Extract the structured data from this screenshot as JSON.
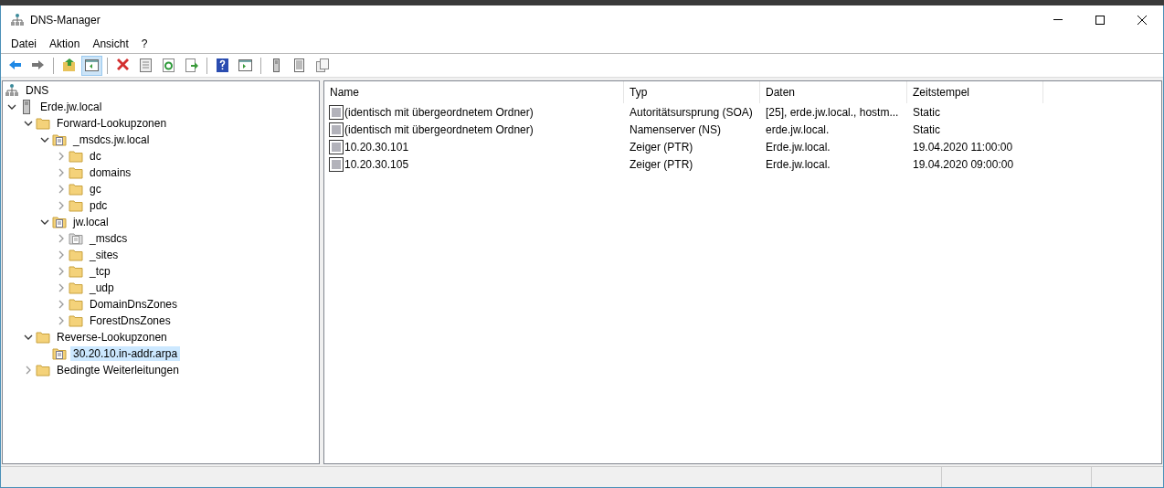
{
  "window": {
    "title": "DNS-Manager"
  },
  "menu": [
    "Datei",
    "Aktion",
    "Ansicht",
    "?"
  ],
  "toolbar": [
    {
      "kind": "back",
      "pressed": false
    },
    {
      "kind": "forward",
      "pressed": false
    },
    {
      "kind": "separator"
    },
    {
      "kind": "up",
      "pressed": false
    },
    {
      "kind": "tree",
      "pressed": true
    },
    {
      "kind": "separator"
    },
    {
      "kind": "delete",
      "pressed": false
    },
    {
      "kind": "properties",
      "pressed": false
    },
    {
      "kind": "refresh",
      "pressed": false
    },
    {
      "kind": "export",
      "pressed": false
    },
    {
      "kind": "separator"
    },
    {
      "kind": "help",
      "pressed": false
    },
    {
      "kind": "pane",
      "pressed": false
    },
    {
      "kind": "separator"
    },
    {
      "kind": "server",
      "pressed": false
    },
    {
      "kind": "list",
      "pressed": false
    },
    {
      "kind": "copy",
      "pressed": false
    }
  ],
  "tree": [
    {
      "label": "DNS",
      "kind": "dns",
      "selected": false,
      "children": [
        {
          "label": "Erde.jw.local",
          "kind": "server",
          "expanded": true,
          "selected": false,
          "children": [
            {
              "label": "Forward-Lookupzonen",
              "kind": "folder",
              "expanded": true,
              "selected": false,
              "children": [
                {
                  "label": "_msdcs.jw.local",
                  "kind": "zone",
                  "expanded": true,
                  "selected": false,
                  "children": [
                    {
                      "label": "dc",
                      "kind": "folder",
                      "expanded": false,
                      "selected": false
                    },
                    {
                      "label": "domains",
                      "kind": "folder",
                      "expanded": false,
                      "selected": false
                    },
                    {
                      "label": "gc",
                      "kind": "folder",
                      "expanded": false,
                      "selected": false
                    },
                    {
                      "label": "pdc",
                      "kind": "folder",
                      "expanded": false,
                      "selected": false
                    }
                  ]
                },
                {
                  "label": "jw.local",
                  "kind": "zone",
                  "expanded": true,
                  "selected": false,
                  "children": [
                    {
                      "label": "_msdcs",
                      "kind": "delegation",
                      "expanded": false,
                      "selected": false
                    },
                    {
                      "label": "_sites",
                      "kind": "folder",
                      "expanded": false,
                      "selected": false
                    },
                    {
                      "label": "_tcp",
                      "kind": "folder",
                      "expanded": false,
                      "selected": false
                    },
                    {
                      "label": "_udp",
                      "kind": "folder",
                      "expanded": false,
                      "selected": false
                    },
                    {
                      "label": "DomainDnsZones",
                      "kind": "folder",
                      "expanded": false,
                      "selected": false
                    },
                    {
                      "label": "ForestDnsZones",
                      "kind": "folder",
                      "expanded": false,
                      "selected": false
                    }
                  ]
                }
              ]
            },
            {
              "label": "Reverse-Lookupzonen",
              "kind": "folder",
              "expanded": true,
              "selected": false,
              "children": [
                {
                  "label": "30.20.10.in-addr.arpa",
                  "kind": "zone",
                  "selected": true
                }
              ]
            },
            {
              "label": "Bedingte Weiterleitungen",
              "kind": "folder",
              "expanded": false,
              "selected": false
            }
          ]
        }
      ]
    }
  ],
  "table": {
    "columns": [
      "Name",
      "Typ",
      "Daten",
      "Zeitstempel"
    ],
    "rows": [
      [
        "(identisch mit übergeordnetem Ordner)",
        "Autoritätsursprung (SOA)",
        "[25], erde.jw.local., hostm...",
        "Static"
      ],
      [
        "(identisch mit übergeordnetem Ordner)",
        "Namenserver (NS)",
        "erde.jw.local.",
        "Static"
      ],
      [
        "10.20.30.101",
        "Zeiger (PTR)",
        "Erde.jw.local.",
        "19.04.2020 11:00:00"
      ],
      [
        "10.20.30.105",
        "Zeiger (PTR)",
        "Erde.jw.local.",
        "19.04.2020 09:00:00"
      ]
    ]
  }
}
